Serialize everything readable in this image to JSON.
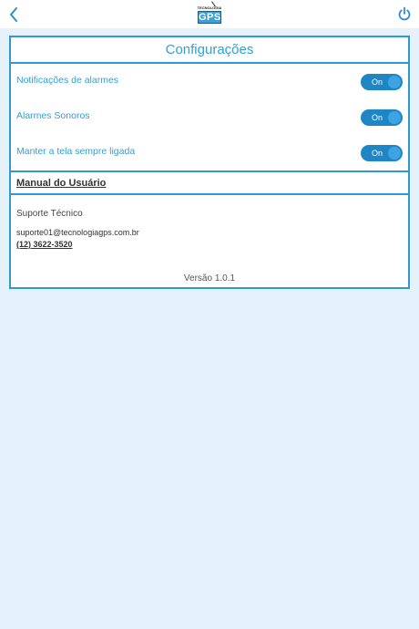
{
  "header": {
    "logo_small_text": "TECNOLOGIA",
    "logo_main_text": "GPS",
    "back_icon": "chevron-left-icon",
    "power_icon": "power-icon"
  },
  "settings": {
    "title": "Configurações",
    "items": [
      {
        "label": "Notificações de alarmes",
        "toggle_label": "On",
        "enabled": true
      },
      {
        "label": "Alarmes Sonoros",
        "toggle_label": "On",
        "enabled": true
      },
      {
        "label": "Manter a tela sempre ligada",
        "toggle_label": "On",
        "enabled": true
      }
    ],
    "manual_label": "Manual do Usuário"
  },
  "support": {
    "title": "Suporte Técnico",
    "email": "suporte01@tecnologiagps.com.br",
    "phone": "(12) 3622-3520"
  },
  "version": "Versão 1.0.1",
  "colors": {
    "accent": "#2fa1d6",
    "toggle_on": "#1f86c6",
    "background": "#e5f2fb"
  }
}
